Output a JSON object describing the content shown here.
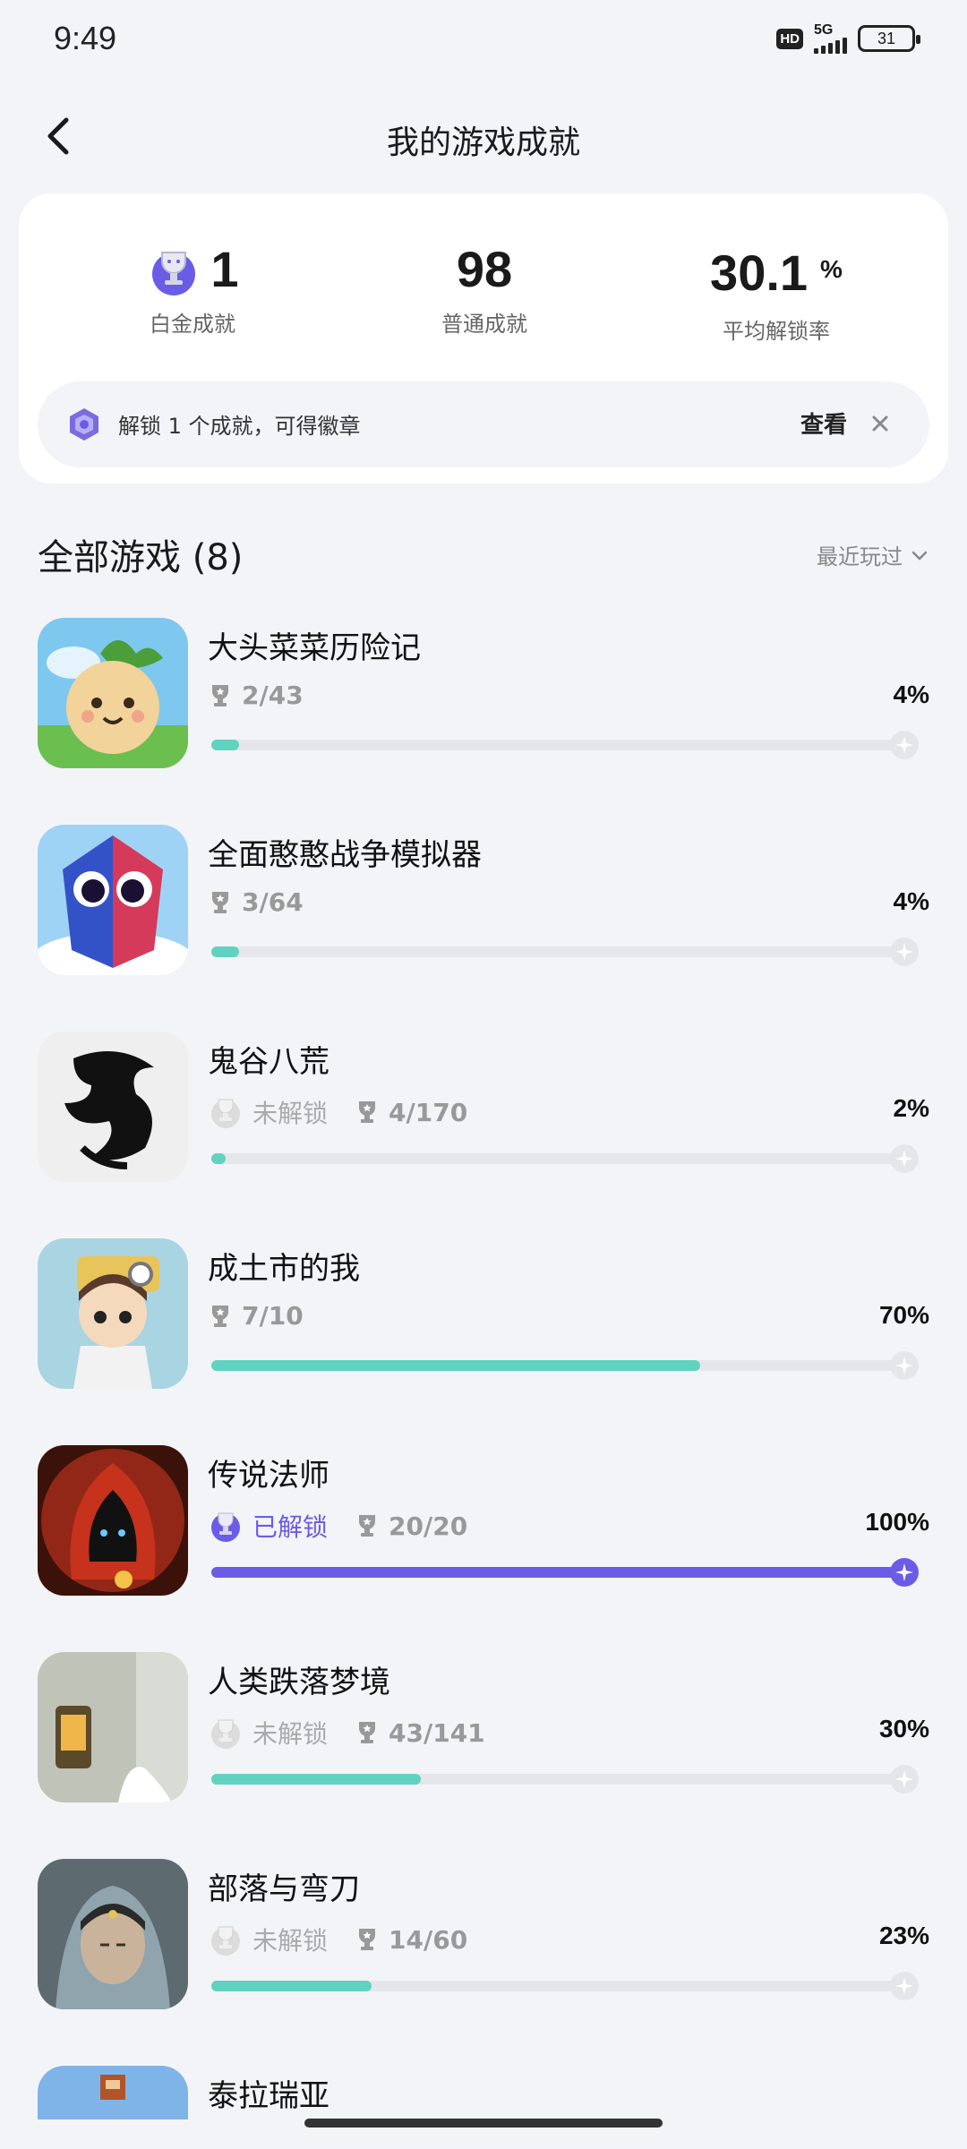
{
  "status": {
    "time": "9:49",
    "hd": "HD",
    "network": "5G",
    "battery": "31"
  },
  "header": {
    "title": "我的游戏成就"
  },
  "summary": {
    "platinum": {
      "value": "1",
      "label": "白金成就"
    },
    "normal": {
      "value": "98",
      "label": "普通成就"
    },
    "rate": {
      "value": "30.1",
      "unit": "%",
      "label": "平均解锁率"
    }
  },
  "banner": {
    "text": "解锁 1 个成就，可得徽章",
    "view": "查看"
  },
  "list": {
    "title": "全部游戏 (8)",
    "sort": "最近玩过"
  },
  "games": [
    {
      "name": "大头菜菜历险记",
      "platinum": "",
      "count": "2/43",
      "percent": "4%",
      "progress": 0.04,
      "color": "#5fd3c0"
    },
    {
      "name": "全面憨憨战争模拟器",
      "platinum": "",
      "count": "3/64",
      "percent": "4%",
      "progress": 0.04,
      "color": "#5fd3c0"
    },
    {
      "name": "鬼谷八荒",
      "platinum": "未解锁",
      "count": "4/170",
      "percent": "2%",
      "progress": 0.02,
      "color": "#5fd3c0"
    },
    {
      "name": "成土市的我",
      "platinum": "",
      "count": "7/10",
      "percent": "70%",
      "progress": 0.7,
      "color": "#5fd3c0"
    },
    {
      "name": "传说法师",
      "platinum": "已解锁",
      "count": "20/20",
      "percent": "100%",
      "progress": 1.0,
      "color": "#6a5ce6"
    },
    {
      "name": "人类跌落梦境",
      "platinum": "未解锁",
      "count": "43/141",
      "percent": "30%",
      "progress": 0.3,
      "color": "#5fd3c0"
    },
    {
      "name": "部落与弯刀",
      "platinum": "未解锁",
      "count": "14/60",
      "percent": "23%",
      "progress": 0.23,
      "color": "#5fd3c0"
    },
    {
      "name": "泰拉瑞亚"
    }
  ]
}
